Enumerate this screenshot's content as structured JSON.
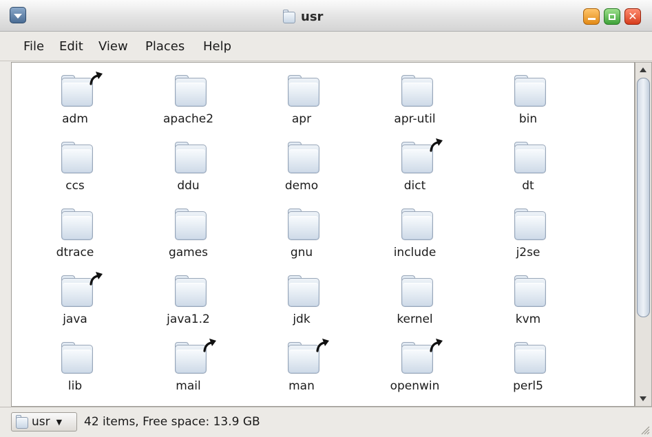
{
  "window": {
    "title": "usr",
    "title_icon": "folder-icon"
  },
  "menubar": {
    "items": [
      "File",
      "Edit",
      "View",
      "Places",
      "Help"
    ]
  },
  "content": {
    "items": [
      {
        "name": "adm",
        "link": true
      },
      {
        "name": "apache2",
        "link": false
      },
      {
        "name": "apr",
        "link": false
      },
      {
        "name": "apr-util",
        "link": false
      },
      {
        "name": "bin",
        "link": false
      },
      {
        "name": "ccs",
        "link": false
      },
      {
        "name": "ddu",
        "link": false
      },
      {
        "name": "demo",
        "link": false
      },
      {
        "name": "dict",
        "link": true
      },
      {
        "name": "dt",
        "link": false
      },
      {
        "name": "dtrace",
        "link": false
      },
      {
        "name": "games",
        "link": false
      },
      {
        "name": "gnu",
        "link": false
      },
      {
        "name": "include",
        "link": false
      },
      {
        "name": "j2se",
        "link": false
      },
      {
        "name": "java",
        "link": true
      },
      {
        "name": "java1.2",
        "link": false
      },
      {
        "name": "jdk",
        "link": false
      },
      {
        "name": "kernel",
        "link": false
      },
      {
        "name": "kvm",
        "link": false
      },
      {
        "name": "lib",
        "link": false
      },
      {
        "name": "mail",
        "link": true
      },
      {
        "name": "man",
        "link": true
      },
      {
        "name": "openwin",
        "link": true
      },
      {
        "name": "perl5",
        "link": false
      }
    ]
  },
  "statusbar": {
    "path_label": "usr",
    "status": "42 items, Free space: 13.9 GB"
  },
  "colors": {
    "minimize": "#f0a030",
    "maximize": "#5cbf4f",
    "close": "#e85530",
    "folder": "#cfdbe8"
  }
}
